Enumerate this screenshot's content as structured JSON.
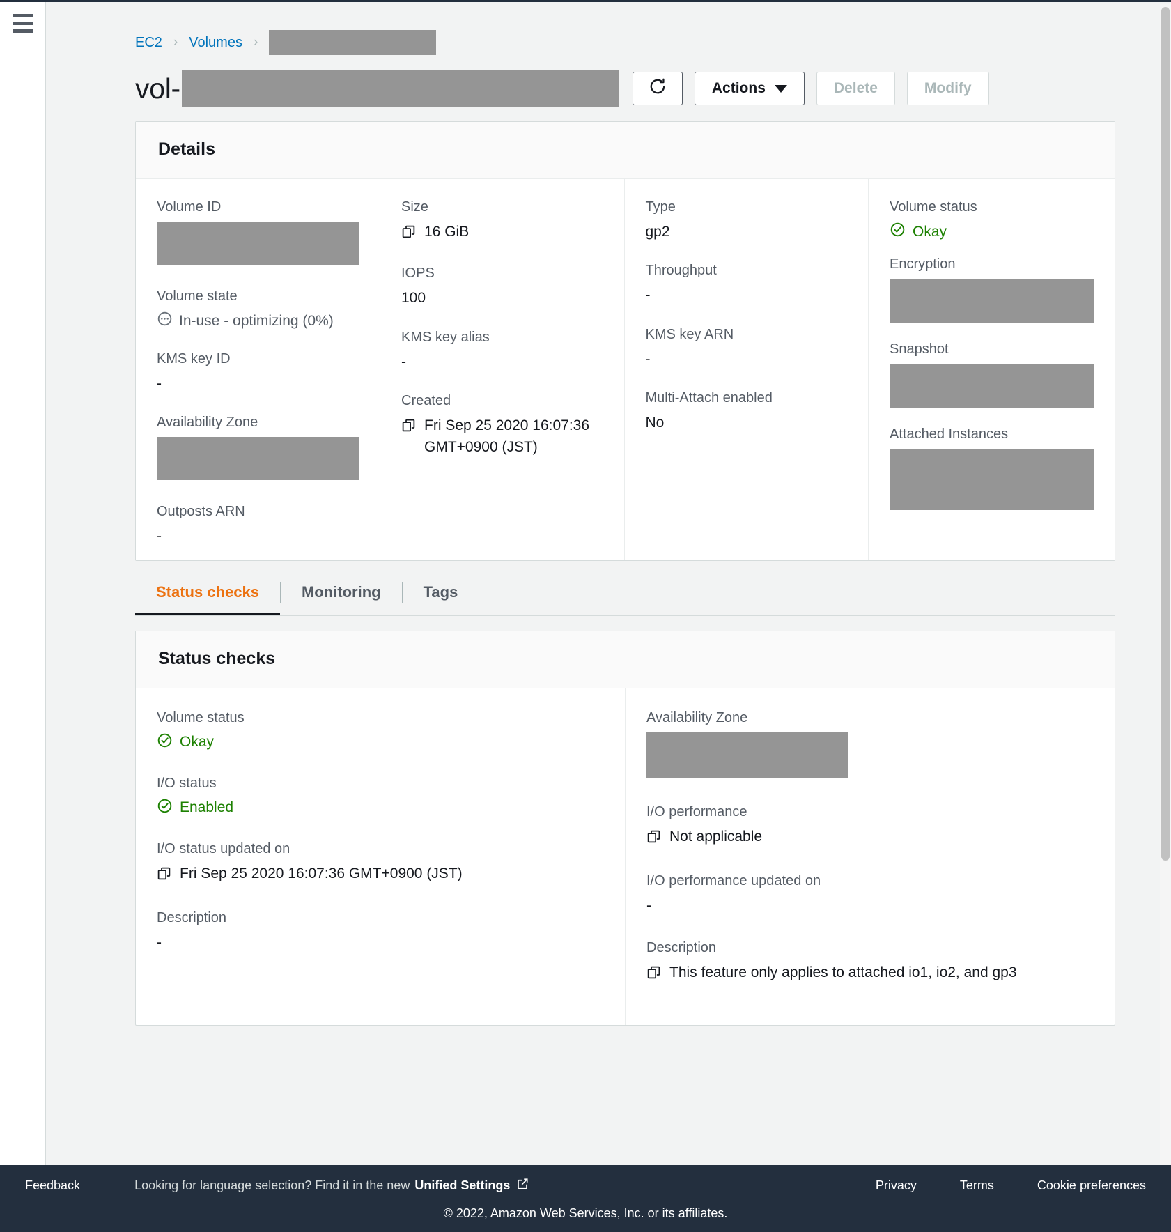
{
  "breadcrumb": {
    "ec2": "EC2",
    "volumes": "Volumes",
    "separator": "›"
  },
  "header": {
    "title_prefix": "vol-",
    "refresh_label": "refresh-icon",
    "actions_label": "Actions",
    "delete_label": "Delete",
    "modify_label": "Modify"
  },
  "details": {
    "title": "Details",
    "col1": {
      "volume_id_label": "Volume ID",
      "volume_state_label": "Volume state",
      "volume_state_value": "In-use - optimizing (0%)",
      "kms_key_id_label": "KMS key ID",
      "kms_key_id_value": "-",
      "availability_zone_label": "Availability Zone",
      "outposts_arn_label": "Outposts ARN",
      "outposts_arn_value": "-"
    },
    "col2": {
      "size_label": "Size",
      "size_value": "16 GiB",
      "iops_label": "IOPS",
      "iops_value": "100",
      "kms_key_alias_label": "KMS key alias",
      "kms_key_alias_value": "-",
      "created_label": "Created",
      "created_value": "Fri Sep 25 2020 16:07:36 GMT+0900 (JST)"
    },
    "col3": {
      "type_label": "Type",
      "type_value": "gp2",
      "throughput_label": "Throughput",
      "throughput_value": "-",
      "kms_key_arn_label": "KMS key ARN",
      "kms_key_arn_value": "-",
      "multi_attach_label": "Multi-Attach enabled",
      "multi_attach_value": "No"
    },
    "col4": {
      "volume_status_label": "Volume status",
      "volume_status_value": "Okay",
      "encryption_label": "Encryption",
      "snapshot_label": "Snapshot",
      "attached_instances_label": "Attached Instances"
    }
  },
  "tabs": [
    {
      "label": "Status checks",
      "active": true
    },
    {
      "label": "Monitoring",
      "active": false
    },
    {
      "label": "Tags",
      "active": false
    }
  ],
  "status_checks": {
    "title": "Status checks",
    "left": {
      "volume_status_label": "Volume status",
      "volume_status_value": "Okay",
      "io_status_label": "I/O status",
      "io_status_value": "Enabled",
      "io_status_updated_label": "I/O status updated on",
      "io_status_updated_value": "Fri Sep 25 2020 16:07:36 GMT+0900 (JST)",
      "description_label": "Description",
      "description_value": "-"
    },
    "right": {
      "availability_zone_label": "Availability Zone",
      "io_performance_label": "I/O performance",
      "io_performance_value": "Not applicable",
      "io_performance_updated_label": "I/O performance updated on",
      "io_performance_updated_value": "-",
      "description_label": "Description",
      "description_value": "This feature only applies to attached io1, io2, and gp3"
    }
  },
  "footer": {
    "feedback": "Feedback",
    "language_prompt": "Looking for language selection? Find it in the new",
    "unified_settings": "Unified Settings",
    "privacy": "Privacy",
    "terms": "Terms",
    "cookie_preferences": "Cookie preferences",
    "copyright": "© 2022, Amazon Web Services, Inc. or its affiliates."
  },
  "colors": {
    "accent_orange": "#ec7211",
    "link_blue": "#0073bb",
    "status_green": "#1d8102",
    "footer_navy": "#232f3e",
    "redaction_gray": "#959595"
  }
}
